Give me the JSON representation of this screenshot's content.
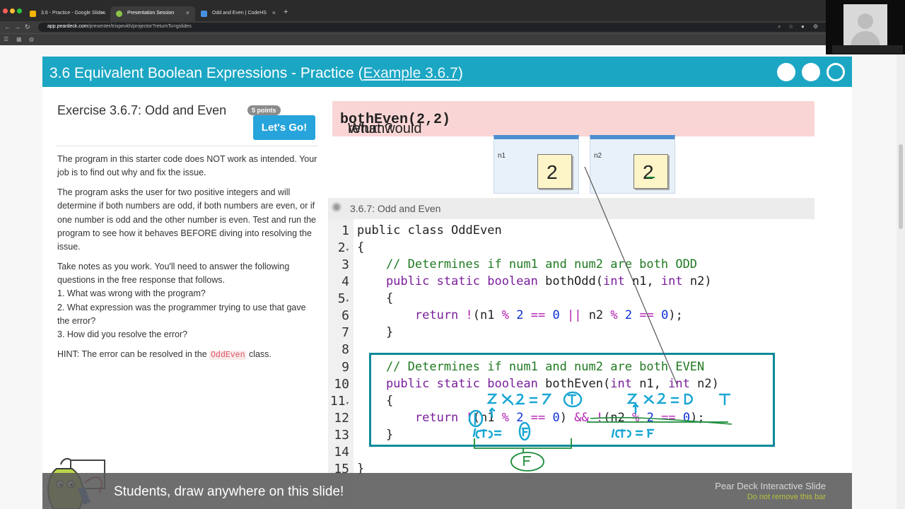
{
  "browser": {
    "tabs": [
      {
        "title": "3.6 - Practice - Google Slides",
        "favicon_color": "#f4b400"
      },
      {
        "title": "Presentation Session",
        "favicon_color": "#8bc34a"
      },
      {
        "title": "Odd and Even | CodeHS",
        "favicon_color": "#4a90e2"
      }
    ],
    "new_tab": "+",
    "url_domain": "app.peardeck.com",
    "url_path": "/presenter/trixpevkh/projector?returnTo=gslides"
  },
  "slide": {
    "title_prefix": "3.6 Equivalent Boolean Expressions - Practice (",
    "title_link": "Example 3.6.7",
    "title_suffix": ")"
  },
  "exercise": {
    "title": "Exercise 3.6.7: Odd and Even",
    "points": "5 points",
    "go_label": "Let's Go!",
    "paragraphs": [
      "The program in this starter code does NOT work as intended. Your job is to find out why and fix the issue.",
      "The program asks the user for two positive integers and will determine if both numbers are odd, if both numbers are even, or if one number is odd and the other number is even. Test and run the program to see how it behaves BEFORE diving into resolving the issue.",
      "Take notes as you work. You'll need to answer the following questions in the free response that follows.",
      "1. What was wrong with the program?",
      "2. What expression was the programmer trying to use that gave the error?",
      "3. How did you resolve the error?"
    ],
    "hint_prefix": "HINT: The error can be resolved in the ",
    "hint_code": "OddEven",
    "hint_suffix": " class."
  },
  "question": {
    "prefix": "What would ",
    "code": "bothEven(2,2)",
    "suffix": " return?"
  },
  "variables": [
    {
      "name": "n1",
      "value": "2"
    },
    {
      "name": "n2",
      "value": "2"
    }
  ],
  "editor": {
    "title": "3.6.7: Odd and Even",
    "line_numbers": [
      "1",
      "2",
      "3",
      "4",
      "5",
      "6",
      "7",
      "8",
      "9",
      "10",
      "11",
      "12",
      "13",
      "14",
      "15"
    ]
  },
  "bottom_bar": {
    "message": "Students, draw anywhere on this slide!",
    "brand": "Pear Deck Interactive Slide",
    "warning": "Do not remove this bar"
  },
  "colors": {
    "header": "#1ba6c3",
    "highlight_box": "#0f8a98",
    "ink_blue": "#1aa7d3",
    "ink_green": "#1a8c3a"
  }
}
